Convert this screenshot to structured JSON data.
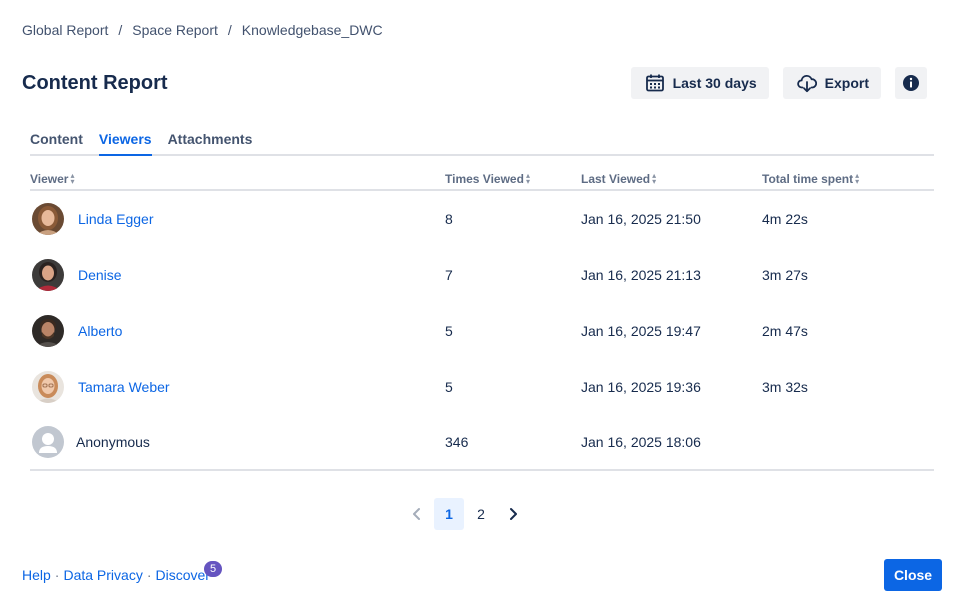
{
  "breadcrumb": {
    "items": [
      "Global Report",
      "Space Report",
      "Knowledgebase_DWC"
    ],
    "separator": "/"
  },
  "page": {
    "title": "Content Report"
  },
  "toolbar": {
    "date_range_label": "Last 30 days",
    "date_range_icon": "calendar-icon",
    "export_label": "Export",
    "export_icon": "cloud-download-icon",
    "info_icon": "info-icon"
  },
  "tabs": [
    {
      "label": "Content",
      "active": false
    },
    {
      "label": "Viewers",
      "active": true
    },
    {
      "label": "Attachments",
      "active": false
    }
  ],
  "table": {
    "headers": {
      "viewer": "Viewer",
      "times_viewed": "Times Viewed",
      "last_viewed": "Last Viewed",
      "total_time": "Total time spent"
    },
    "rows": [
      {
        "name": "Linda Egger",
        "times_viewed": "8",
        "last_viewed": "Jan 16, 2025 21:50",
        "total_time": "4m 22s",
        "link": true
      },
      {
        "name": "Denise",
        "times_viewed": "7",
        "last_viewed": "Jan 16, 2025 21:13",
        "total_time": "3m 27s",
        "link": true
      },
      {
        "name": "Alberto",
        "times_viewed": "5",
        "last_viewed": "Jan 16, 2025 19:47",
        "total_time": "2m 47s",
        "link": true
      },
      {
        "name": "Tamara Weber",
        "times_viewed": "5",
        "last_viewed": "Jan 16, 2025 19:36",
        "total_time": "3m 32s",
        "link": true
      },
      {
        "name": "Anonymous",
        "times_viewed": "346",
        "last_viewed": "Jan 16, 2025 18:06",
        "total_time": "",
        "link": false
      }
    ]
  },
  "pagination": {
    "pages": [
      "1",
      "2"
    ],
    "current": "1"
  },
  "footer": {
    "help": "Help",
    "privacy": "Data Privacy",
    "discover": "Discover",
    "discover_badge": "5",
    "close_label": "Close"
  },
  "colors": {
    "accent": "#0c66e4",
    "badge": "#6554c0",
    "button_bg": "#f1f2f4"
  }
}
